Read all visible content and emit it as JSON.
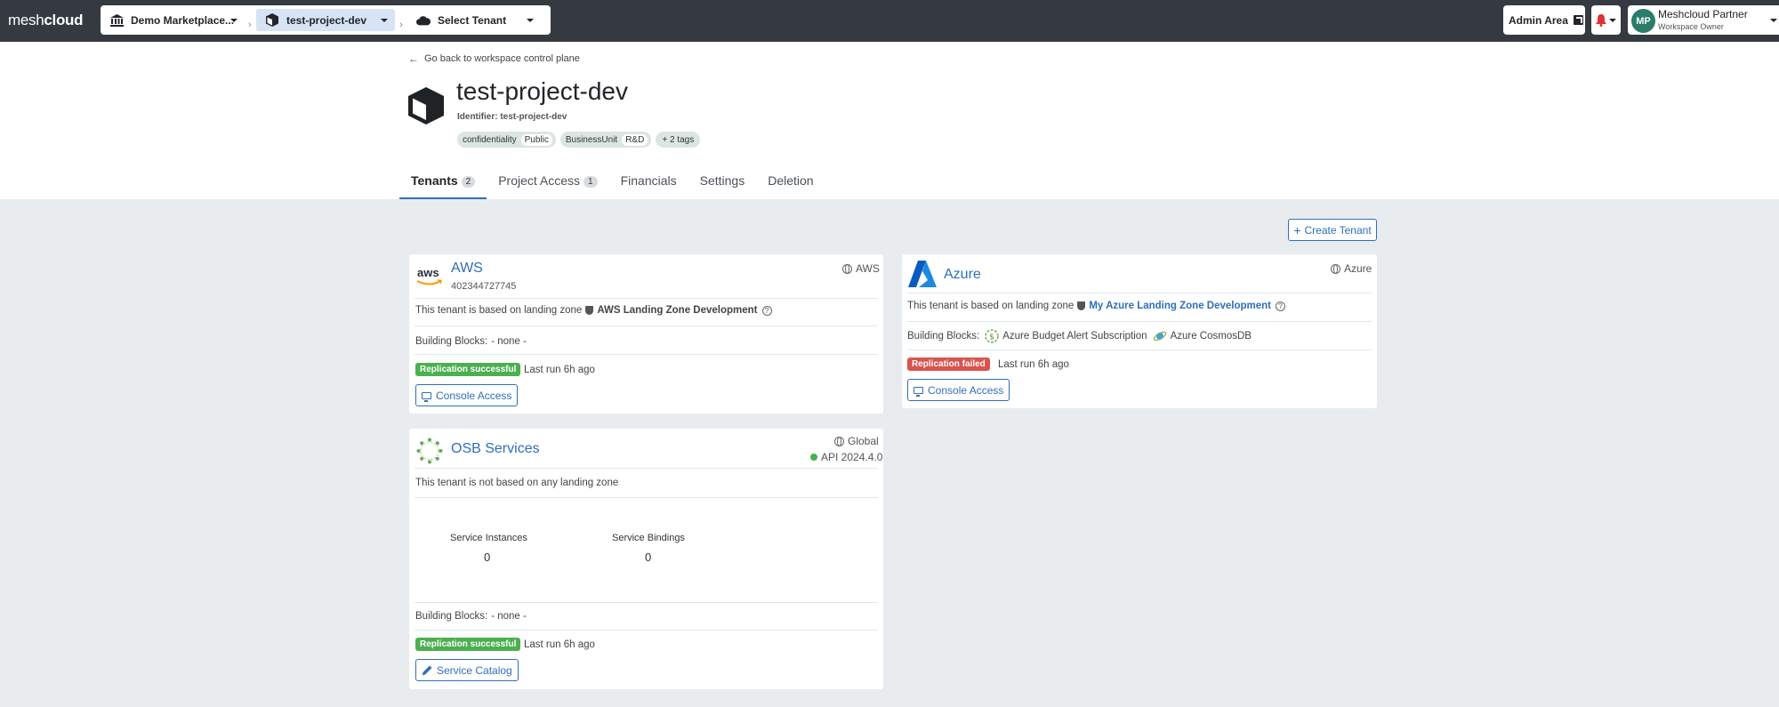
{
  "topbar": {
    "logo_light": "mesh",
    "logo_bold": "cloud",
    "breadcrumbs": [
      {
        "label": "Demo Marketplace...",
        "icon": "bank-icon"
      },
      {
        "label": "test-project-dev",
        "icon": "cube-icon"
      },
      {
        "label": "Select Tenant",
        "icon": "cloud-icon"
      }
    ],
    "admin_area": "Admin Area",
    "user": {
      "initials": "MP",
      "name": "Meshcloud Partner",
      "role": "Workspace Owner"
    }
  },
  "header": {
    "back_link": "Go back to workspace control plane",
    "title": "test-project-dev",
    "identifier": "Identifier: test-project-dev",
    "tags": [
      {
        "key": "confidentiality",
        "value": "Public"
      },
      {
        "key": "BusinessUnit",
        "value": "R&D"
      }
    ],
    "more_tags": "+ 2 tags",
    "tabs": [
      {
        "label": "Tenants",
        "badge": "2"
      },
      {
        "label": "Project Access",
        "badge": "1"
      },
      {
        "label": "Financials"
      },
      {
        "label": "Settings"
      },
      {
        "label": "Deletion"
      }
    ]
  },
  "create_tenant": "Create Tenant",
  "tenants": {
    "aws": {
      "name": "AWS",
      "account": "402344727745",
      "platform": "AWS",
      "lz_prefix": "This tenant is based on landing zone",
      "landing_zone": "AWS Landing Zone Development",
      "bb_label": "Building Blocks:",
      "bb_value": "- none -",
      "status": "Replication successful",
      "last_run": "Last run 6h ago",
      "action": "Console Access",
      "logo_text": "aws"
    },
    "azure": {
      "name": "Azure",
      "platform": "Azure",
      "lz_prefix": "This tenant is based on landing zone",
      "landing_zone": "My Azure Landing Zone Development",
      "bb_label": "Building Blocks:",
      "bb_items": [
        "Azure Budget Alert Subscription",
        "Azure CosmosDB"
      ],
      "status": "Replication failed",
      "last_run": "Last run 6h ago",
      "action": "Console Access"
    },
    "osb": {
      "name": "OSB Services",
      "platform": "Global",
      "api": "API 2024.4.0",
      "lz_text": "This tenant is not based on any landing zone",
      "service_instances_label": "Service Instances",
      "service_instances": "0",
      "service_bindings_label": "Service Bindings",
      "service_bindings": "0",
      "bb_label": "Building Blocks:",
      "bb_value": "- none -",
      "status": "Replication successful",
      "last_run": "Last run 6h ago",
      "action": "Service Catalog"
    }
  },
  "colors": {
    "topbar": "#343a40",
    "accent": "#2f6fb8",
    "success": "#4caf50",
    "danger": "#d9534f"
  }
}
